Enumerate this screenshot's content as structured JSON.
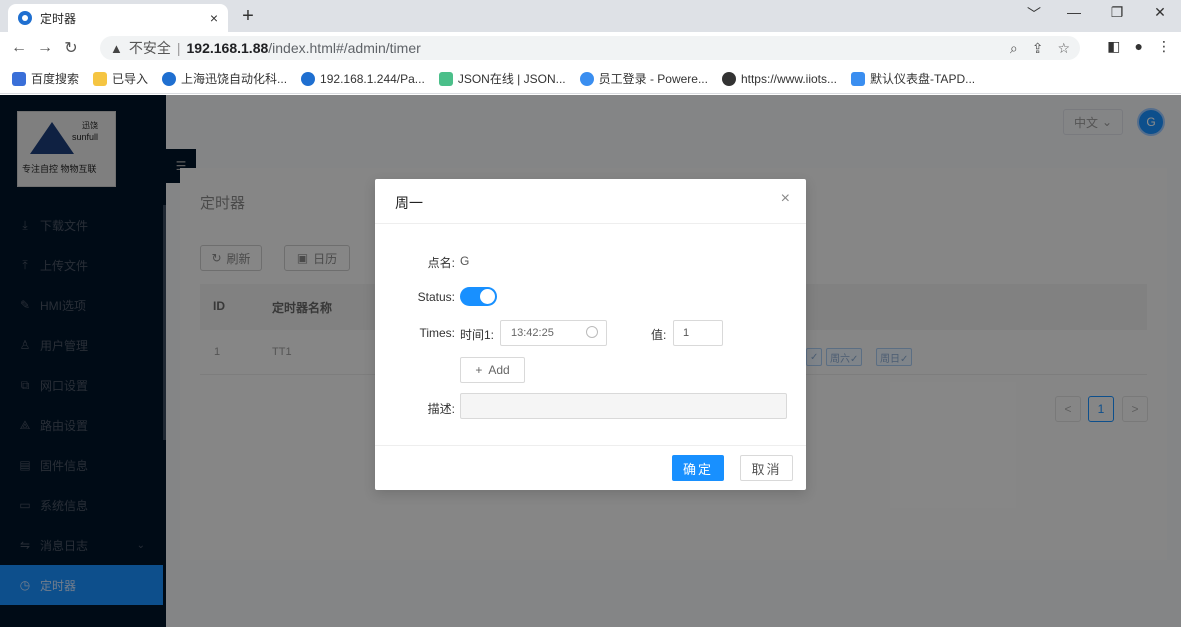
{
  "browser": {
    "tab_title": "定时器",
    "tab_close": "×",
    "new_tab": "+",
    "window_controls": [
      "﹀",
      "—",
      "❐",
      "✕"
    ],
    "address": {
      "security_label": "不安全",
      "host": "192.168.1.88",
      "path": "/index.html#/admin/timer"
    },
    "bookmarks": [
      {
        "label": "百度搜索",
        "color": "#3a6fd8"
      },
      {
        "label": "已导入",
        "color": "#f5c542"
      },
      {
        "label": "上海迅饶自动化科...",
        "color": "#1f6fd0"
      },
      {
        "label": "192.168.1.244/Pa...",
        "color": "#1f6fd0"
      },
      {
        "label": "JSON在线 | JSON...",
        "color": "#4bbf8a"
      },
      {
        "label": "员工登录 - Powere...",
        "color": "#3a8ef0"
      },
      {
        "label": "https://www.iiots...",
        "color": "#333333"
      },
      {
        "label": "默认仪表盘-TAPD...",
        "color": "#3a8ef0"
      }
    ]
  },
  "sidebar": {
    "logo": {
      "brand_cn": "迅饶",
      "brand_en": "sunfull",
      "slogan": "专注自控 物物互联"
    },
    "collapse_icon": "☰",
    "items": [
      {
        "label": "下载文件",
        "icon": "⤓"
      },
      {
        "label": "上传文件",
        "icon": "⤒"
      },
      {
        "label": "HMI选项",
        "icon": "✎"
      },
      {
        "label": "用户管理",
        "icon": "♙"
      },
      {
        "label": "网口设置",
        "icon": "⧉"
      },
      {
        "label": "路由设置",
        "icon": "⟁"
      },
      {
        "label": "固件信息",
        "icon": "▤"
      },
      {
        "label": "系统信息",
        "icon": "▭"
      },
      {
        "label": "消息日志",
        "icon": "⇋",
        "arrow": "⌄"
      },
      {
        "label": "定时器",
        "icon": "◷"
      }
    ]
  },
  "header": {
    "language": "中文",
    "language_arrow": "⌄",
    "avatar_letter": "G"
  },
  "page": {
    "title": "定时器",
    "refresh_button": "刷新",
    "calendar_button": "日历",
    "table": {
      "columns": [
        "ID",
        "定时器名称"
      ],
      "rows": [
        {
          "id": "1",
          "name": "TT1"
        }
      ],
      "day_tags": [
        "✓",
        "周六✓",
        "周日✓"
      ]
    },
    "pagination": {
      "prev": "<",
      "current": "1",
      "next": ">"
    }
  },
  "modal": {
    "title": "周一",
    "close": "×",
    "fields": {
      "name_label": "点名:",
      "name_value": "G",
      "status_label": "Status:",
      "status_on": true,
      "times_label": "Times:",
      "time1_label": "时间1:",
      "time1_value": "13:42:25",
      "value_label": "值:",
      "value_value": "1",
      "add_button": "Add",
      "add_icon": "+",
      "desc_label": "描述:",
      "desc_value": ""
    },
    "ok_button": "确定",
    "cancel_button": "取消"
  },
  "colors": {
    "primary": "#1890ff",
    "sidebar_bg": "#001529"
  }
}
